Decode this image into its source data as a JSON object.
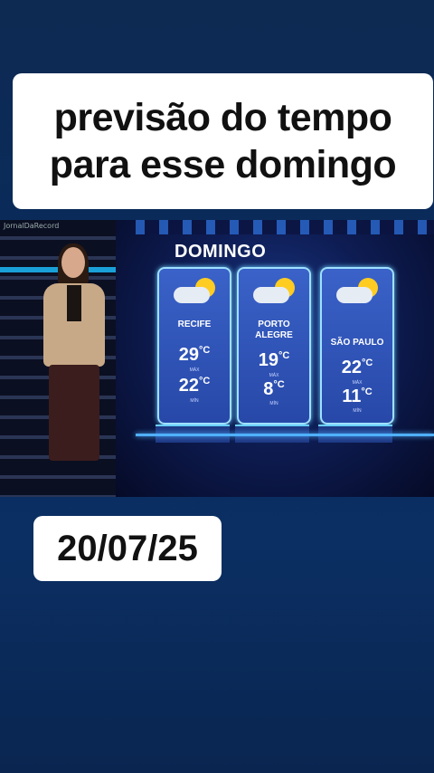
{
  "caption": {
    "line1": "previsão do tempo",
    "line2": "para esse domingo"
  },
  "video": {
    "watermark": "JornalDaRecord",
    "panel_title": "DOMINGO",
    "cities": [
      {
        "name": "RECIFE",
        "max": "29",
        "min": "22",
        "unit": "°C",
        "max_label": "MÁX",
        "min_label": "MÍN"
      },
      {
        "name": "PORTO ALEGRE",
        "max": "19",
        "min": "8",
        "unit": "°C",
        "max_label": "MÁX",
        "min_label": "MÍN"
      },
      {
        "name": "SÃO PAULO",
        "max": "22",
        "min": "11",
        "unit": "°C",
        "max_label": "MÁX",
        "min_label": "MÍN"
      }
    ],
    "icons": [
      "sun-behind-cloud-icon"
    ]
  },
  "date": "20/07/25",
  "colors": {
    "background": "#0b2f63",
    "caption_bg": "#ffffff",
    "card": "#2f55b8",
    "accent": "#6ad0ff"
  }
}
